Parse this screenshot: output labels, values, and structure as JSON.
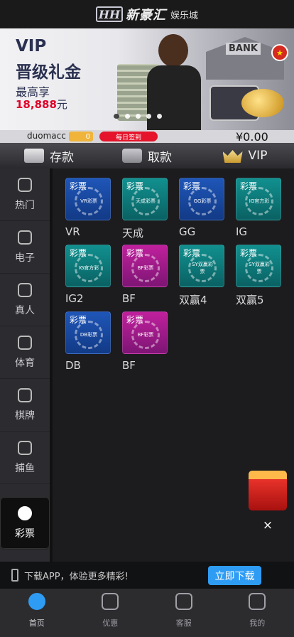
{
  "header": {
    "logo_mark": "HH",
    "logo_main": "新豪汇",
    "logo_sub": "娱乐城"
  },
  "banner": {
    "line1": "VIP",
    "line2": "晋级礼金",
    "line3": "最高享",
    "amount": "18,888",
    "amount_unit": "元",
    "bank_label": "BANK",
    "flag": "★"
  },
  "user": {
    "username": "duomacc",
    "vip_level": "0",
    "sign_label": "每日签到",
    "balance": "¥0.00"
  },
  "actions": [
    {
      "label": "存款",
      "icon": "card-icon"
    },
    {
      "label": "取款",
      "icon": "wallet-icon"
    },
    {
      "label": "VIP",
      "icon": "crown-icon"
    }
  ],
  "sidebar": [
    {
      "label": "热门",
      "icon": "fire-icon"
    },
    {
      "label": "电子",
      "icon": "gamepad-icon"
    },
    {
      "label": "真人",
      "icon": "dice-icon"
    },
    {
      "label": "体育",
      "icon": "soccer-icon"
    },
    {
      "label": "棋牌",
      "icon": "cards-icon"
    },
    {
      "label": "捕鱼",
      "icon": "fish-icon"
    },
    {
      "label": "彩票",
      "icon": "lottery-ball-icon",
      "active": true
    }
  ],
  "games": [
    {
      "name": "VR",
      "tag": "彩票",
      "card_text": "VR彩票",
      "color": "blue"
    },
    {
      "name": "天成",
      "tag": "彩票",
      "card_text": "天成彩票",
      "color": "teal"
    },
    {
      "name": "GG",
      "tag": "彩票",
      "card_text": "GG彩票",
      "color": "blue"
    },
    {
      "name": "IG",
      "tag": "彩票",
      "card_text": "IG官方彩",
      "color": "teal"
    },
    {
      "name": "IG2",
      "tag": "彩票",
      "card_text": "IG官方彩",
      "color": "teal"
    },
    {
      "name": "BF",
      "tag": "彩票",
      "card_text": "BF彩票",
      "color": "purple"
    },
    {
      "name": "双赢4",
      "tag": "彩票",
      "card_text": "SY双赢彩票",
      "color": "teal"
    },
    {
      "name": "双赢5",
      "tag": "彩票",
      "card_text": "SY双赢彩票",
      "color": "teal"
    },
    {
      "name": "DB",
      "tag": "彩票",
      "card_text": "DB彩票",
      "color": "blue"
    },
    {
      "name": "BF",
      "tag": "彩票",
      "card_text": "BF彩票",
      "color": "purple"
    }
  ],
  "download": {
    "text": "下载APP，体验更多精彩!",
    "button": "立即下载"
  },
  "close_label": "×",
  "tabs": [
    {
      "label": "首页",
      "icon": "home-icon",
      "active": true
    },
    {
      "label": "优惠",
      "icon": "gift-icon"
    },
    {
      "label": "客服",
      "icon": "support-icon"
    },
    {
      "label": "我的",
      "icon": "profile-icon"
    }
  ],
  "colors": {
    "accent": "#2f9cf4",
    "sign_red": "#e5142a",
    "vip_gold": "#f0b43a"
  }
}
